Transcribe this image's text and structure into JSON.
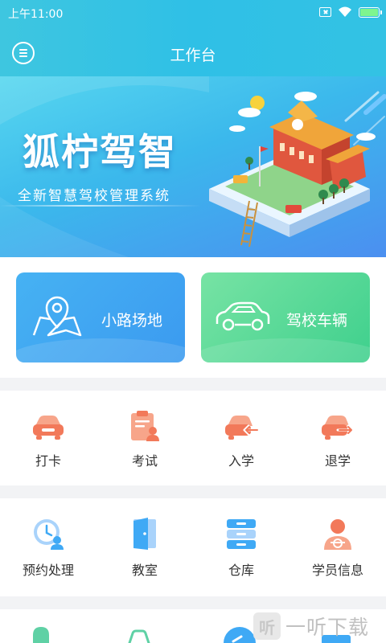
{
  "status_bar": {
    "time": "上午11:00"
  },
  "header": {
    "title": "工作台"
  },
  "banner": {
    "title": "狐柠驾智",
    "subtitle": "全新智慧驾校管理系统"
  },
  "cards": [
    {
      "label": "小路场地",
      "color": "#3b9af0"
    },
    {
      "label": "驾校车辆",
      "color": "#3fd08d"
    }
  ],
  "grid_row_1": [
    {
      "label": "打卡",
      "icon": "car-icon"
    },
    {
      "label": "考试",
      "icon": "exam-clipboard-icon"
    },
    {
      "label": "入学",
      "icon": "car-enter-icon"
    },
    {
      "label": "退学",
      "icon": "car-exit-icon"
    }
  ],
  "grid_row_2": [
    {
      "label": "预约处理",
      "icon": "appointment-clock-icon"
    },
    {
      "label": "教室",
      "icon": "classroom-door-icon"
    },
    {
      "label": "仓库",
      "icon": "warehouse-drawers-icon"
    },
    {
      "label": "学员信息",
      "icon": "student-info-icon"
    }
  ],
  "watermark": {
    "text": "一听下载",
    "box": "听"
  },
  "colors": {
    "header": "#33c2e4",
    "accent_orange": "#f2795a",
    "accent_blue": "#3fa9f5"
  }
}
